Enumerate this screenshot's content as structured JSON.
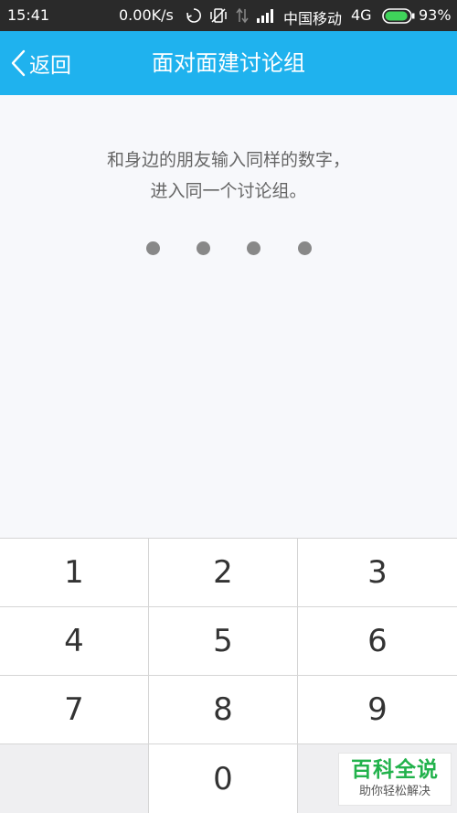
{
  "status_bar": {
    "time": "15:41",
    "speed": "0.00K/s",
    "carrier": "中国移动",
    "network": "4G",
    "battery": "93%",
    "battery_level": 0.93
  },
  "header": {
    "back_label": "返回",
    "title": "面对面建讨论组"
  },
  "instruction": {
    "line1": "和身边的朋友输入同样的数字，",
    "line2": "进入同一个讨论组。"
  },
  "pin": {
    "length": 4,
    "entered": 0
  },
  "keypad": {
    "keys": [
      "1",
      "2",
      "3",
      "4",
      "5",
      "6",
      "7",
      "8",
      "9",
      "",
      "0",
      ""
    ]
  },
  "watermark": {
    "brand": "百科全说",
    "slogan": "助你轻松解决"
  },
  "colors": {
    "header": "#1fb2ee",
    "status_bar": "#2a2a2a",
    "background": "#f7f8fb",
    "watermark_green": "#22b24c"
  }
}
